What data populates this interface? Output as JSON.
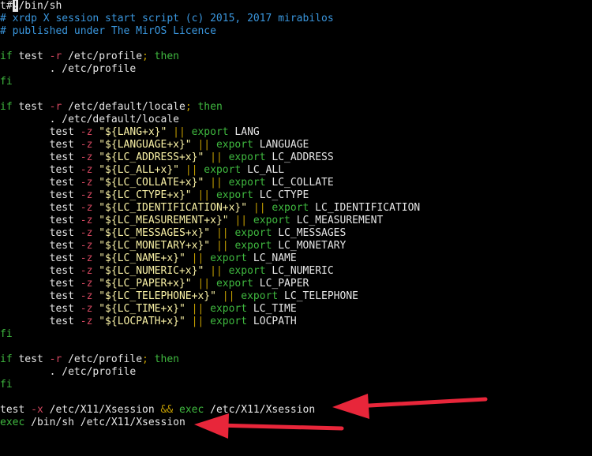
{
  "colors": {
    "background": "#000000",
    "plain": "#e6e6e6",
    "comment": "#3a96dd",
    "keyword": "#3fb83f",
    "flag": "#d2475f",
    "operator": "#c19c00",
    "string": "#f9f1a5",
    "arrow": "#e8263a"
  },
  "lines": [
    [
      {
        "t": "plain",
        "v": "t#"
      },
      {
        "t": "cursor",
        "v": "!"
      },
      {
        "t": "plain",
        "v": "/bin/sh"
      }
    ],
    [
      {
        "t": "comment",
        "v": "# xrdp X session start script (c) 2015, 2017 mirabilos"
      }
    ],
    [
      {
        "t": "comment",
        "v": "# published under The MirOS Licence"
      }
    ],
    [],
    [
      {
        "t": "keyword",
        "v": "if"
      },
      {
        "t": "plain",
        "v": " test "
      },
      {
        "t": "flag",
        "v": "-r"
      },
      {
        "t": "plain",
        "v": " /etc/profile"
      },
      {
        "t": "op",
        "v": ";"
      },
      {
        "t": "keyword",
        "v": " then"
      }
    ],
    [
      {
        "t": "plain",
        "v": "        . /etc/profile"
      }
    ],
    [
      {
        "t": "keyword",
        "v": "fi"
      }
    ],
    [],
    [
      {
        "t": "keyword",
        "v": "if"
      },
      {
        "t": "plain",
        "v": " test "
      },
      {
        "t": "flag",
        "v": "-r"
      },
      {
        "t": "plain",
        "v": " /etc/default/locale"
      },
      {
        "t": "op",
        "v": ";"
      },
      {
        "t": "keyword",
        "v": " then"
      }
    ],
    [
      {
        "t": "plain",
        "v": "        . /etc/default/locale"
      }
    ],
    [
      {
        "t": "plain",
        "v": "        test "
      },
      {
        "t": "flag",
        "v": "-z"
      },
      {
        "t": "plain",
        "v": " "
      },
      {
        "t": "string",
        "v": "\"${LANG+x}\""
      },
      {
        "t": "plain",
        "v": " "
      },
      {
        "t": "op",
        "v": "||"
      },
      {
        "t": "plain",
        "v": " "
      },
      {
        "t": "keyword",
        "v": "export"
      },
      {
        "t": "plain",
        "v": " LANG"
      }
    ],
    [
      {
        "t": "plain",
        "v": "        test "
      },
      {
        "t": "flag",
        "v": "-z"
      },
      {
        "t": "plain",
        "v": " "
      },
      {
        "t": "string",
        "v": "\"${LANGUAGE+x}\""
      },
      {
        "t": "plain",
        "v": " "
      },
      {
        "t": "op",
        "v": "||"
      },
      {
        "t": "plain",
        "v": " "
      },
      {
        "t": "keyword",
        "v": "export"
      },
      {
        "t": "plain",
        "v": " LANGUAGE"
      }
    ],
    [
      {
        "t": "plain",
        "v": "        test "
      },
      {
        "t": "flag",
        "v": "-z"
      },
      {
        "t": "plain",
        "v": " "
      },
      {
        "t": "string",
        "v": "\"${LC_ADDRESS+x}\""
      },
      {
        "t": "plain",
        "v": " "
      },
      {
        "t": "op",
        "v": "||"
      },
      {
        "t": "plain",
        "v": " "
      },
      {
        "t": "keyword",
        "v": "export"
      },
      {
        "t": "plain",
        "v": " LC_ADDRESS"
      }
    ],
    [
      {
        "t": "plain",
        "v": "        test "
      },
      {
        "t": "flag",
        "v": "-z"
      },
      {
        "t": "plain",
        "v": " "
      },
      {
        "t": "string",
        "v": "\"${LC_ALL+x}\""
      },
      {
        "t": "plain",
        "v": " "
      },
      {
        "t": "op",
        "v": "||"
      },
      {
        "t": "plain",
        "v": " "
      },
      {
        "t": "keyword",
        "v": "export"
      },
      {
        "t": "plain",
        "v": " LC_ALL"
      }
    ],
    [
      {
        "t": "plain",
        "v": "        test "
      },
      {
        "t": "flag",
        "v": "-z"
      },
      {
        "t": "plain",
        "v": " "
      },
      {
        "t": "string",
        "v": "\"${LC_COLLATE+x}\""
      },
      {
        "t": "plain",
        "v": " "
      },
      {
        "t": "op",
        "v": "||"
      },
      {
        "t": "plain",
        "v": " "
      },
      {
        "t": "keyword",
        "v": "export"
      },
      {
        "t": "plain",
        "v": " LC_COLLATE"
      }
    ],
    [
      {
        "t": "plain",
        "v": "        test "
      },
      {
        "t": "flag",
        "v": "-z"
      },
      {
        "t": "plain",
        "v": " "
      },
      {
        "t": "string",
        "v": "\"${LC_CTYPE+x}\""
      },
      {
        "t": "plain",
        "v": " "
      },
      {
        "t": "op",
        "v": "||"
      },
      {
        "t": "plain",
        "v": " "
      },
      {
        "t": "keyword",
        "v": "export"
      },
      {
        "t": "plain",
        "v": " LC_CTYPE"
      }
    ],
    [
      {
        "t": "plain",
        "v": "        test "
      },
      {
        "t": "flag",
        "v": "-z"
      },
      {
        "t": "plain",
        "v": " "
      },
      {
        "t": "string",
        "v": "\"${LC_IDENTIFICATION+x}\""
      },
      {
        "t": "plain",
        "v": " "
      },
      {
        "t": "op",
        "v": "||"
      },
      {
        "t": "plain",
        "v": " "
      },
      {
        "t": "keyword",
        "v": "export"
      },
      {
        "t": "plain",
        "v": " LC_IDENTIFICATION"
      }
    ],
    [
      {
        "t": "plain",
        "v": "        test "
      },
      {
        "t": "flag",
        "v": "-z"
      },
      {
        "t": "plain",
        "v": " "
      },
      {
        "t": "string",
        "v": "\"${LC_MEASUREMENT+x}\""
      },
      {
        "t": "plain",
        "v": " "
      },
      {
        "t": "op",
        "v": "||"
      },
      {
        "t": "plain",
        "v": " "
      },
      {
        "t": "keyword",
        "v": "export"
      },
      {
        "t": "plain",
        "v": " LC_MEASUREMENT"
      }
    ],
    [
      {
        "t": "plain",
        "v": "        test "
      },
      {
        "t": "flag",
        "v": "-z"
      },
      {
        "t": "plain",
        "v": " "
      },
      {
        "t": "string",
        "v": "\"${LC_MESSAGES+x}\""
      },
      {
        "t": "plain",
        "v": " "
      },
      {
        "t": "op",
        "v": "||"
      },
      {
        "t": "plain",
        "v": " "
      },
      {
        "t": "keyword",
        "v": "export"
      },
      {
        "t": "plain",
        "v": " LC_MESSAGES"
      }
    ],
    [
      {
        "t": "plain",
        "v": "        test "
      },
      {
        "t": "flag",
        "v": "-z"
      },
      {
        "t": "plain",
        "v": " "
      },
      {
        "t": "string",
        "v": "\"${LC_MONETARY+x}\""
      },
      {
        "t": "plain",
        "v": " "
      },
      {
        "t": "op",
        "v": "||"
      },
      {
        "t": "plain",
        "v": " "
      },
      {
        "t": "keyword",
        "v": "export"
      },
      {
        "t": "plain",
        "v": " LC_MONETARY"
      }
    ],
    [
      {
        "t": "plain",
        "v": "        test "
      },
      {
        "t": "flag",
        "v": "-z"
      },
      {
        "t": "plain",
        "v": " "
      },
      {
        "t": "string",
        "v": "\"${LC_NAME+x}\""
      },
      {
        "t": "plain",
        "v": " "
      },
      {
        "t": "op",
        "v": "||"
      },
      {
        "t": "plain",
        "v": " "
      },
      {
        "t": "keyword",
        "v": "export"
      },
      {
        "t": "plain",
        "v": " LC_NAME"
      }
    ],
    [
      {
        "t": "plain",
        "v": "        test "
      },
      {
        "t": "flag",
        "v": "-z"
      },
      {
        "t": "plain",
        "v": " "
      },
      {
        "t": "string",
        "v": "\"${LC_NUMERIC+x}\""
      },
      {
        "t": "plain",
        "v": " "
      },
      {
        "t": "op",
        "v": "||"
      },
      {
        "t": "plain",
        "v": " "
      },
      {
        "t": "keyword",
        "v": "export"
      },
      {
        "t": "plain",
        "v": " LC_NUMERIC"
      }
    ],
    [
      {
        "t": "plain",
        "v": "        test "
      },
      {
        "t": "flag",
        "v": "-z"
      },
      {
        "t": "plain",
        "v": " "
      },
      {
        "t": "string",
        "v": "\"${LC_PAPER+x}\""
      },
      {
        "t": "plain",
        "v": " "
      },
      {
        "t": "op",
        "v": "||"
      },
      {
        "t": "plain",
        "v": " "
      },
      {
        "t": "keyword",
        "v": "export"
      },
      {
        "t": "plain",
        "v": " LC_PAPER"
      }
    ],
    [
      {
        "t": "plain",
        "v": "        test "
      },
      {
        "t": "flag",
        "v": "-z"
      },
      {
        "t": "plain",
        "v": " "
      },
      {
        "t": "string",
        "v": "\"${LC_TELEPHONE+x}\""
      },
      {
        "t": "plain",
        "v": " "
      },
      {
        "t": "op",
        "v": "||"
      },
      {
        "t": "plain",
        "v": " "
      },
      {
        "t": "keyword",
        "v": "export"
      },
      {
        "t": "plain",
        "v": " LC_TELEPHONE"
      }
    ],
    [
      {
        "t": "plain",
        "v": "        test "
      },
      {
        "t": "flag",
        "v": "-z"
      },
      {
        "t": "plain",
        "v": " "
      },
      {
        "t": "string",
        "v": "\"${LC_TIME+x}\""
      },
      {
        "t": "plain",
        "v": " "
      },
      {
        "t": "op",
        "v": "||"
      },
      {
        "t": "plain",
        "v": " "
      },
      {
        "t": "keyword",
        "v": "export"
      },
      {
        "t": "plain",
        "v": " LC_TIME"
      }
    ],
    [
      {
        "t": "plain",
        "v": "        test "
      },
      {
        "t": "flag",
        "v": "-z"
      },
      {
        "t": "plain",
        "v": " "
      },
      {
        "t": "string",
        "v": "\"${LOCPATH+x}\""
      },
      {
        "t": "plain",
        "v": " "
      },
      {
        "t": "op",
        "v": "||"
      },
      {
        "t": "plain",
        "v": " "
      },
      {
        "t": "keyword",
        "v": "export"
      },
      {
        "t": "plain",
        "v": " LOCPATH"
      }
    ],
    [
      {
        "t": "keyword",
        "v": "fi"
      }
    ],
    [],
    [
      {
        "t": "keyword",
        "v": "if"
      },
      {
        "t": "plain",
        "v": " test "
      },
      {
        "t": "flag",
        "v": "-r"
      },
      {
        "t": "plain",
        "v": " /etc/profile"
      },
      {
        "t": "op",
        "v": ";"
      },
      {
        "t": "keyword",
        "v": " then"
      }
    ],
    [
      {
        "t": "plain",
        "v": "        . /etc/profile"
      }
    ],
    [
      {
        "t": "keyword",
        "v": "fi"
      }
    ],
    [],
    [
      {
        "t": "plain",
        "v": "test "
      },
      {
        "t": "flag",
        "v": "-x"
      },
      {
        "t": "plain",
        "v": " /etc/X11/Xsession "
      },
      {
        "t": "op",
        "v": "&&"
      },
      {
        "t": "plain",
        "v": " "
      },
      {
        "t": "keyword",
        "v": "exec"
      },
      {
        "t": "plain",
        "v": " /etc/X11/Xsession"
      }
    ],
    [
      {
        "t": "keyword",
        "v": "exec"
      },
      {
        "t": "plain",
        "v": " /bin/sh /etc/X11/Xsession"
      }
    ]
  ]
}
